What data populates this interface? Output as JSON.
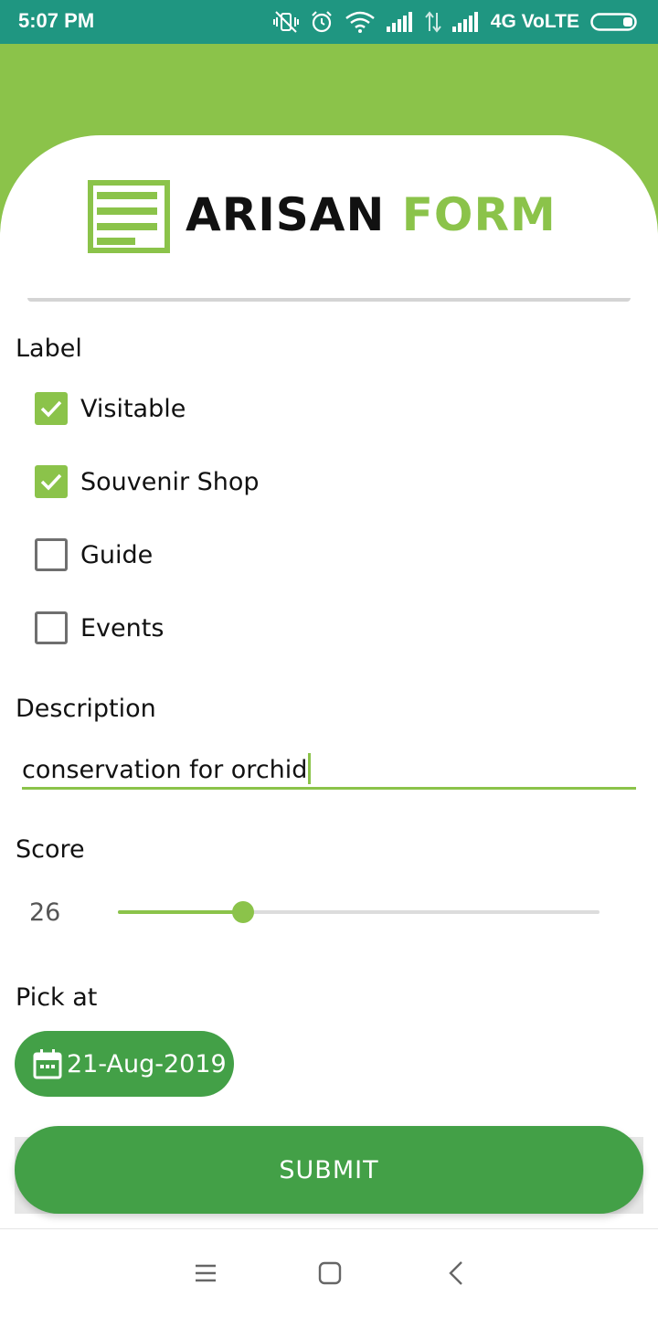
{
  "status_bar": {
    "time": "5:07 PM",
    "network": "4G VoLTE",
    "icons": [
      "vibrate-off-icon",
      "alarm-icon",
      "wifi-icon",
      "signal-icon",
      "data-arrows-icon",
      "signal-icon",
      "battery-icon"
    ]
  },
  "logo": {
    "word1": "ARISAN",
    "word2": "FORM",
    "icon": "form-document-icon"
  },
  "label_section": {
    "title": "Label",
    "options": [
      {
        "label": "Visitable",
        "checked": true
      },
      {
        "label": "Souvenir Shop",
        "checked": true
      },
      {
        "label": "Guide",
        "checked": false
      },
      {
        "label": "Events",
        "checked": false
      }
    ]
  },
  "description": {
    "title": "Description",
    "value": "conservation for orchid"
  },
  "score": {
    "title": "Score",
    "value": "26",
    "fraction": 0.26
  },
  "pick_at": {
    "title": "Pick at",
    "date": "21-Aug-2019",
    "icon": "calendar-icon"
  },
  "submit": {
    "label": "SUBMIT"
  },
  "colors": {
    "accent": "#8bc34a",
    "primary": "#43a047",
    "status_bar": "#1f9681"
  },
  "nav_bar": {
    "icons": [
      "menu-icon",
      "home-square-icon",
      "back-chevron-icon"
    ]
  }
}
